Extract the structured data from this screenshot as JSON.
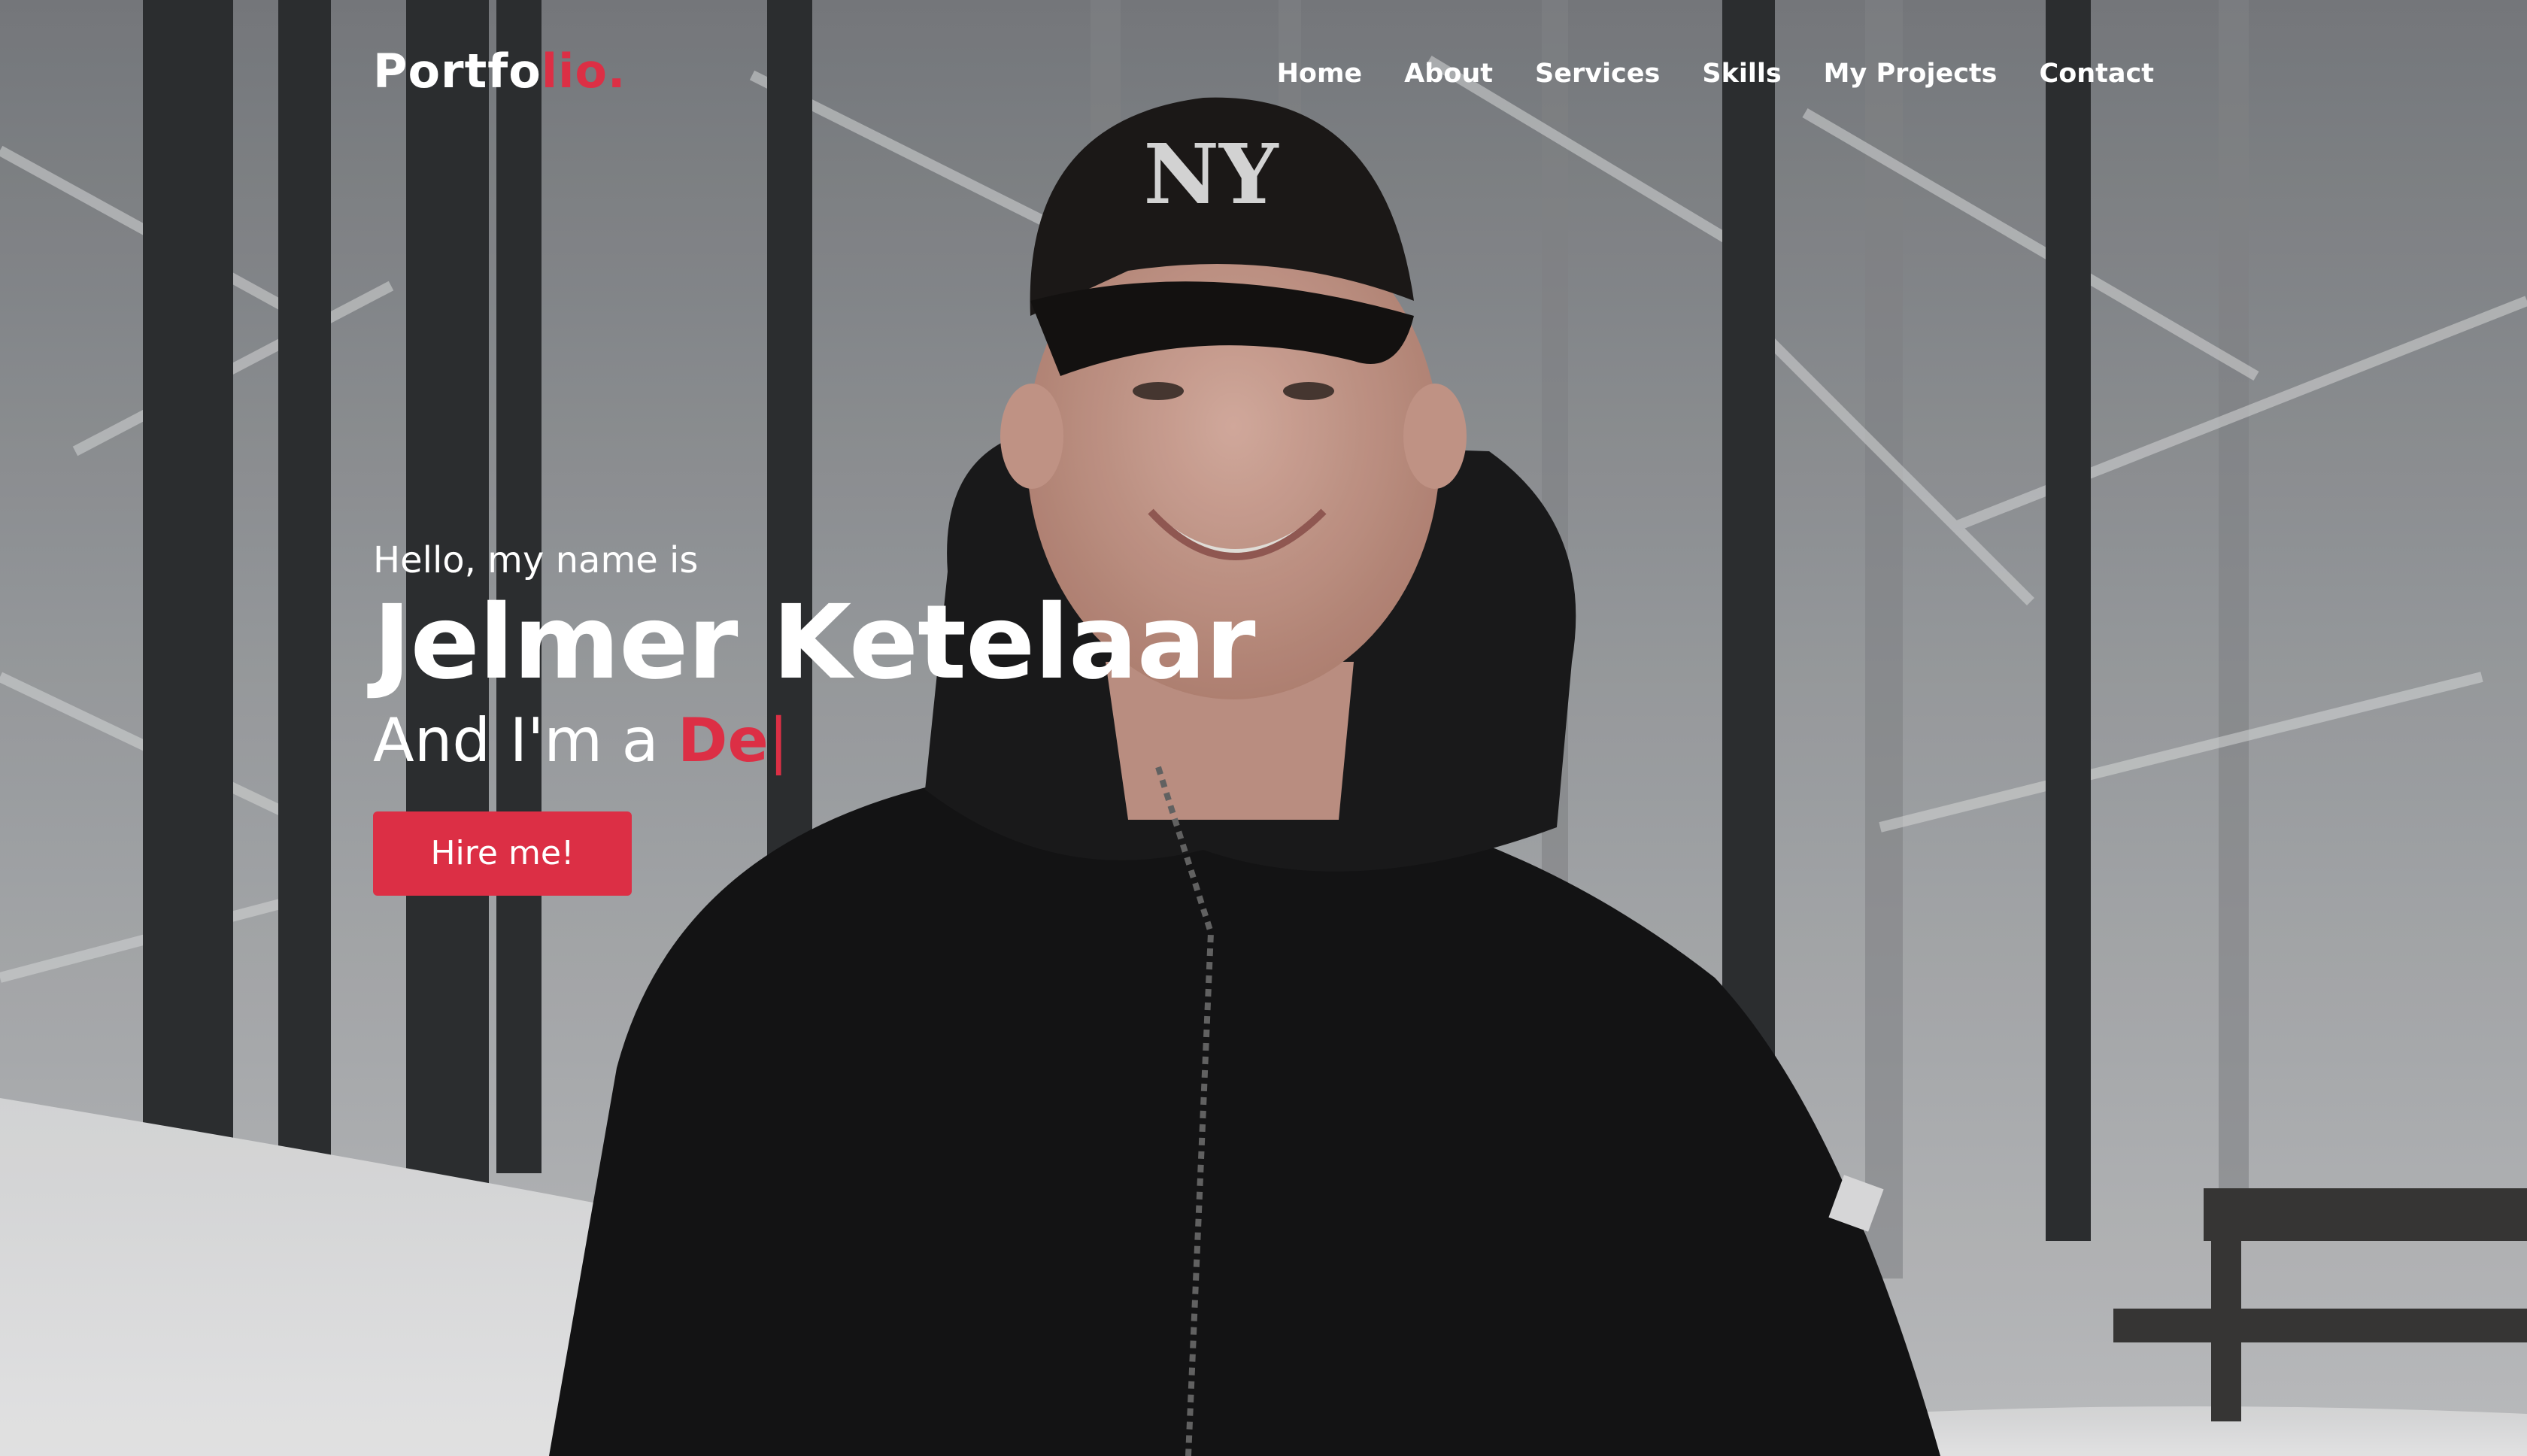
{
  "navbar": {
    "logo_main": "Portfo",
    "logo_accent": "lio.",
    "menu": [
      "Home",
      "About",
      "Services",
      "Skills",
      "My Projects",
      "Contact"
    ]
  },
  "hero": {
    "greeting": "Hello, my name is",
    "name": "Jelmer Ketelaar",
    "role_prefix": "And I'm a ",
    "role_typed": "De",
    "cursor": "|",
    "hire_button": "Hire me!"
  },
  "colors": {
    "accent": "#dc2f45",
    "text": "#ffffff"
  },
  "background": {
    "icon": "snowy-forest-portrait-photo"
  }
}
